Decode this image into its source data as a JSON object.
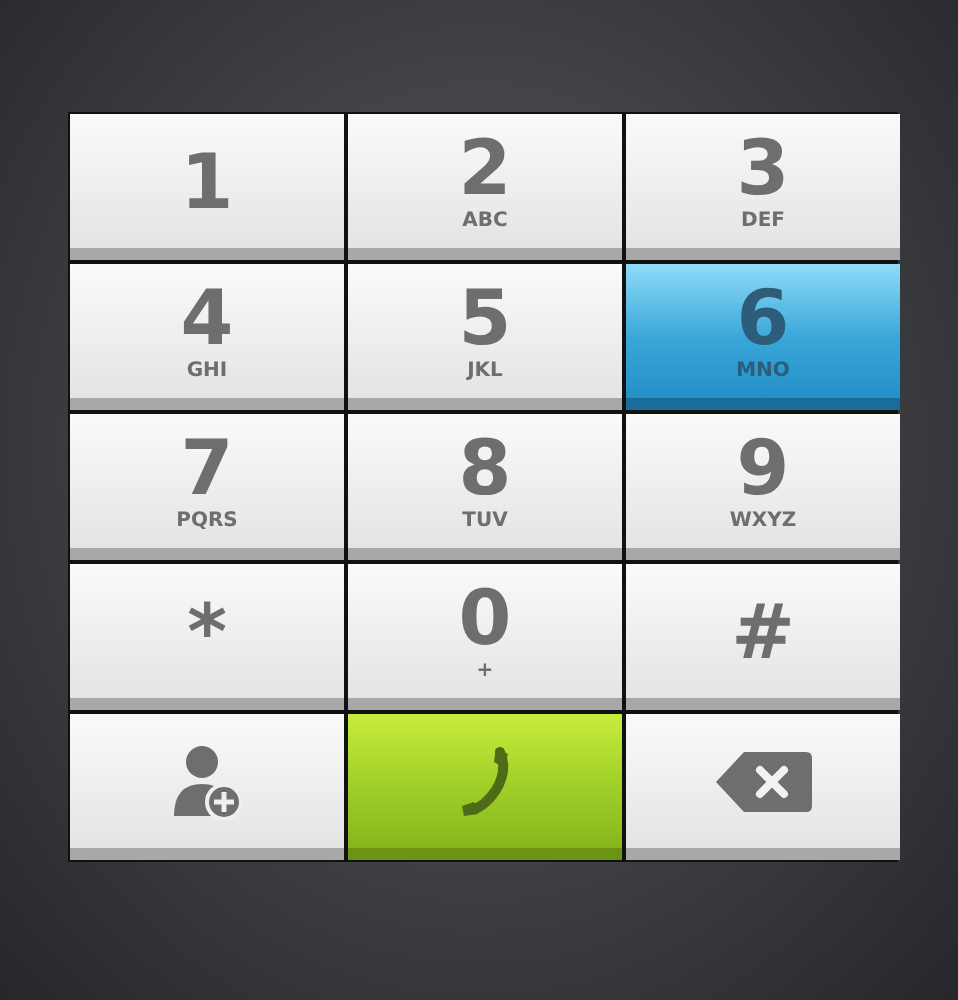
{
  "keys": [
    {
      "kind": "digit",
      "digit": "1",
      "selected": false
    },
    {
      "kind": "digit",
      "digit": "2",
      "letters": "ABC",
      "selected": false
    },
    {
      "kind": "digit",
      "digit": "3",
      "letters": "DEF",
      "selected": false
    },
    {
      "kind": "digit",
      "digit": "4",
      "letters": "GHI",
      "selected": false
    },
    {
      "kind": "digit",
      "digit": "5",
      "letters": "JKL",
      "selected": false
    },
    {
      "kind": "digit",
      "digit": "6",
      "letters": "MNO",
      "selected": true
    },
    {
      "kind": "digit",
      "digit": "7",
      "letters": "PQRS",
      "selected": false
    },
    {
      "kind": "digit",
      "digit": "8",
      "letters": "TUV",
      "selected": false
    },
    {
      "kind": "digit",
      "digit": "9",
      "letters": "WXYZ",
      "selected": false
    },
    {
      "kind": "digit",
      "digit": "*",
      "selected": false
    },
    {
      "kind": "digit",
      "digit": "0",
      "letters": "+",
      "selected": false
    },
    {
      "kind": "digit",
      "digit": "#",
      "selected": false
    },
    {
      "kind": "add-contact",
      "selected": false
    },
    {
      "kind": "call",
      "selected": false
    },
    {
      "kind": "backspace",
      "selected": false
    }
  ]
}
